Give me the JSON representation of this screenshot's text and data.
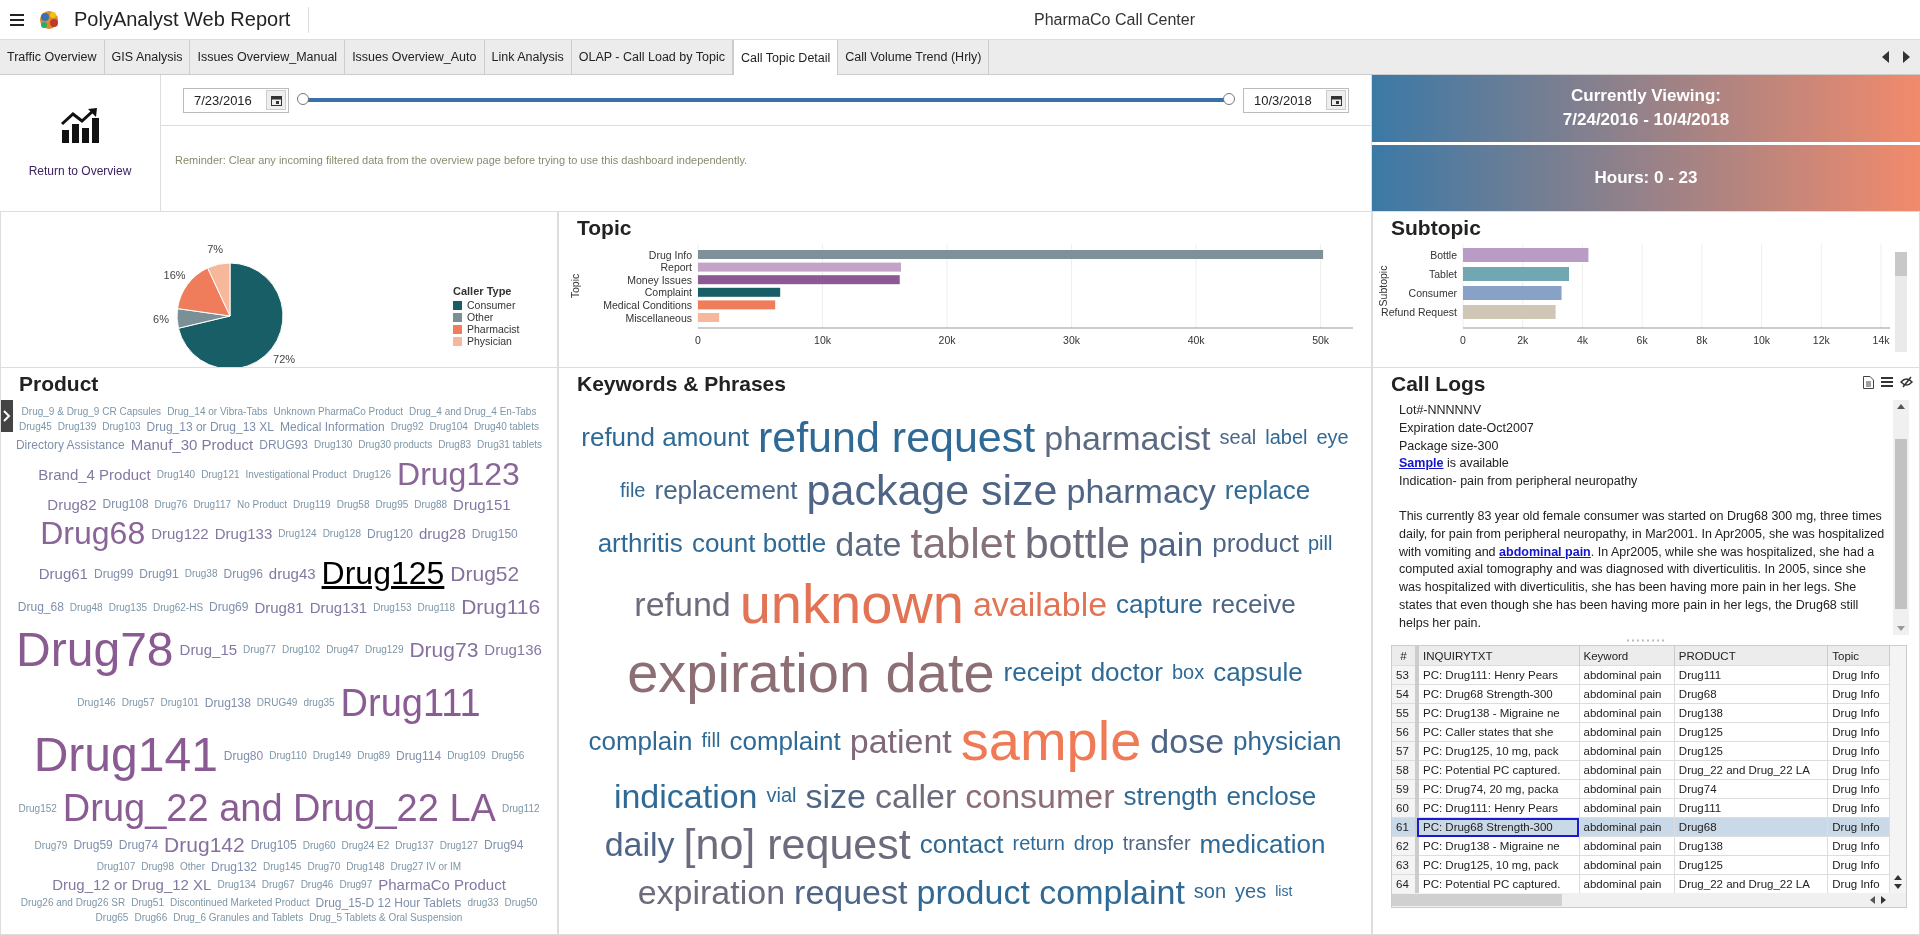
{
  "header": {
    "app_title": "PolyAnalyst Web Report",
    "report_title": "PharmaCo Call Center"
  },
  "tabs": [
    {
      "label": "Traffic Overview",
      "selected": false
    },
    {
      "label": "GIS Analysis",
      "selected": false
    },
    {
      "label": "Issues Overview_Manual",
      "selected": false
    },
    {
      "label": "Issues Overview_Auto",
      "selected": false
    },
    {
      "label": "Link Analysis",
      "selected": false
    },
    {
      "label": "OLAP - Call Load by Topic",
      "selected": false
    },
    {
      "label": "Call Topic Detail",
      "selected": true
    },
    {
      "label": "Call Volume Trend (Hrly)",
      "selected": false
    }
  ],
  "overview": {
    "return_link": "Return to Overview"
  },
  "filters": {
    "start_date": "7/23/2016",
    "end_date": "10/3/2018",
    "range_slider": {
      "level": 1
    },
    "reminder": "Reminder: Clear any incoming filtered data from the overview page before trying to use this dashboard independently."
  },
  "viewing": {
    "title": "Currently Viewing:",
    "range": "7/24/2016 - 10/4/2018",
    "hours": "Hours: 0 - 23"
  },
  "caller_type": {
    "chart_data": {
      "type": "pie",
      "legend": {
        "title": "Caller Type"
      },
      "categories": [
        "Consumer",
        "Other",
        "Pharmacist",
        "Physician"
      ],
      "values": [
        72,
        6,
        16,
        7
      ],
      "value_labels": [
        "72%",
        "6%",
        "16%",
        "7%"
      ],
      "colors": [
        "#175e66",
        "#7b8f97",
        "#ef7d5c",
        "#f7b79a"
      ]
    }
  },
  "topic": {
    "title": "Topic",
    "chart_data": {
      "type": "bar",
      "grid": true,
      "orientation": "horizontal",
      "ylabel": "Topic",
      "categories": [
        "Drug Info",
        "Report",
        "Money Issues",
        "Complaint",
        "Medical Conditions",
        "Miscellaneous"
      ],
      "values": [
        50200,
        16300,
        16200,
        6600,
        6200,
        1700
      ],
      "colors": [
        "#7e9199",
        "#c3a4c8",
        "#8b5a93",
        "#175e66",
        "#ef7d5c",
        "#f7b79a"
      ],
      "xlim": [
        0,
        52600
      ],
      "xticks": [
        {
          "value": 0,
          "label": "0"
        },
        {
          "value": 10000,
          "label": "10k"
        },
        {
          "value": 20000,
          "label": "20k"
        },
        {
          "value": 30000,
          "label": "30k"
        },
        {
          "value": 40000,
          "label": "40k"
        },
        {
          "value": 50000,
          "label": "50k"
        }
      ]
    }
  },
  "subtopic": {
    "title": "Subtopic",
    "chart_data": {
      "type": "bar",
      "grid": true,
      "orientation": "horizontal",
      "ylabel": "Subtopic",
      "categories": [
        "Bottle",
        "Tablet",
        "Consumer",
        "Refund Request"
      ],
      "values": [
        4200,
        3550,
        3300,
        3100
      ],
      "colors": [
        "#b99cc5",
        "#70a7b1",
        "#87a1c7",
        "#d0c6b6"
      ],
      "xlim": [
        0,
        14300
      ],
      "xticks": [
        {
          "value": 0,
          "label": "0"
        },
        {
          "value": 2000,
          "label": "2k"
        },
        {
          "value": 4000,
          "label": "4k"
        },
        {
          "value": 6000,
          "label": "6k"
        },
        {
          "value": 8000,
          "label": "8k"
        },
        {
          "value": 10000,
          "label": "10k"
        },
        {
          "value": 12000,
          "label": "12k"
        },
        {
          "value": 14000,
          "label": "14k"
        }
      ]
    }
  },
  "product": {
    "title": "Product",
    "words": [
      {
        "text": "Drug_9 & Drug_9 CR Capsules",
        "kind": "tiny",
        "selected": false
      },
      {
        "text": "Drug_14 or Vibra-Tabs",
        "kind": "tiny",
        "selected": false
      },
      {
        "text": "Unknown PharmaCo Product",
        "kind": "tiny",
        "selected": false
      },
      {
        "text": "Drug_4 and Drug_4 En-Tabs",
        "kind": "tiny",
        "selected": false
      },
      {
        "text": "Drug45",
        "kind": "tiny",
        "selected": false
      },
      {
        "text": "Drug139",
        "kind": "tiny",
        "selected": false
      },
      {
        "text": "Drug103",
        "kind": "tiny",
        "selected": false
      },
      {
        "text": "Drug_13 or Drug_13 XL",
        "kind": "small",
        "selected": false
      },
      {
        "text": "Medical Information",
        "kind": "small",
        "selected": false
      },
      {
        "text": "Drug92",
        "kind": "tiny",
        "selected": false
      },
      {
        "text": "Drug104",
        "kind": "tiny",
        "selected": false
      },
      {
        "text": "Drug40 tablets",
        "kind": "tiny",
        "selected": false
      },
      {
        "text": "Directory Assistance",
        "kind": "small",
        "selected": false
      },
      {
        "text": "Manuf_30 Product",
        "kind": "normal",
        "selected": false
      },
      {
        "text": "DRUG93",
        "kind": "small",
        "selected": false
      },
      {
        "text": "Drug130",
        "kind": "tiny",
        "selected": false
      },
      {
        "text": "Drug30 products",
        "kind": "tiny",
        "selected": false
      },
      {
        "text": "Drug83",
        "kind": "tiny",
        "selected": false
      },
      {
        "text": "Drug31 tablets",
        "kind": "tiny",
        "selected": false
      },
      {
        "text": "Brand_4 Product",
        "kind": "normal",
        "selected": false
      },
      {
        "text": "Drug140",
        "kind": "tiny",
        "selected": false
      },
      {
        "text": "Drug121",
        "kind": "tiny",
        "selected": false
      },
      {
        "text": "Investigational Product",
        "kind": "tiny",
        "selected": false
      },
      {
        "text": "Drug126",
        "kind": "tiny",
        "selected": false
      },
      {
        "text": "Drug123",
        "kind": "large",
        "selected": false
      },
      {
        "text": "Drug82",
        "kind": "normal",
        "selected": false
      },
      {
        "text": "Drug108",
        "kind": "small",
        "selected": false
      },
      {
        "text": "Drug76",
        "kind": "tiny",
        "selected": false
      },
      {
        "text": "Drug117",
        "kind": "tiny",
        "selected": false
      },
      {
        "text": "No Product",
        "kind": "tiny",
        "selected": false
      },
      {
        "text": "Drug119",
        "kind": "tiny",
        "selected": false
      },
      {
        "text": "Drug58",
        "kind": "tiny",
        "selected": false
      },
      {
        "text": "Drug95",
        "kind": "tiny",
        "selected": false
      },
      {
        "text": "Drug88",
        "kind": "tiny",
        "selected": false
      },
      {
        "text": "Drug151",
        "kind": "normal",
        "selected": false
      },
      {
        "text": "Drug68",
        "kind": "large",
        "selected": false
      },
      {
        "text": "Drug122",
        "kind": "normal",
        "selected": false
      },
      {
        "text": "Drug133",
        "kind": "normal",
        "selected": false
      },
      {
        "text": "Drug124",
        "kind": "tiny",
        "selected": false
      },
      {
        "text": "Drug128",
        "kind": "tiny",
        "selected": false
      },
      {
        "text": "Drug120",
        "kind": "small",
        "selected": false
      },
      {
        "text": "drug28",
        "kind": "normal",
        "selected": false
      },
      {
        "text": "Drug150",
        "kind": "small",
        "selected": false
      },
      {
        "text": "Drug61",
        "kind": "normal",
        "selected": false
      },
      {
        "text": "Drug99",
        "kind": "small",
        "selected": false
      },
      {
        "text": "Drug91",
        "kind": "small",
        "selected": false
      },
      {
        "text": "Drug38",
        "kind": "tiny",
        "selected": false
      },
      {
        "text": "Drug96",
        "kind": "small",
        "selected": false
      },
      {
        "text": "drug43",
        "kind": "normal",
        "selected": false
      },
      {
        "text": "Drug125",
        "kind": "large",
        "selected": true
      },
      {
        "text": "Drug52",
        "kind": "medium",
        "selected": false
      },
      {
        "text": "Drug_68",
        "kind": "small",
        "selected": false
      },
      {
        "text": "Drug48",
        "kind": "tiny",
        "selected": false
      },
      {
        "text": "Drug135",
        "kind": "tiny",
        "selected": false
      },
      {
        "text": "Drug62-HS",
        "kind": "tiny",
        "selected": false
      },
      {
        "text": "Drug69",
        "kind": "small",
        "selected": false
      },
      {
        "text": "Drug81",
        "kind": "normal",
        "selected": false
      },
      {
        "text": "Drug131",
        "kind": "normal",
        "selected": false
      },
      {
        "text": "Drug153",
        "kind": "tiny",
        "selected": false
      },
      {
        "text": "Drug118",
        "kind": "tiny",
        "selected": false
      },
      {
        "text": "Drug116",
        "kind": "medium",
        "selected": false
      },
      {
        "text": "Drug78",
        "kind": "huge",
        "selected": false
      },
      {
        "text": "Drug_15",
        "kind": "normal",
        "selected": false
      },
      {
        "text": "Drug77",
        "kind": "tiny",
        "selected": false
      },
      {
        "text": "Drug102",
        "kind": "tiny",
        "selected": false
      },
      {
        "text": "Drug47",
        "kind": "tiny",
        "selected": false
      },
      {
        "text": "Drug129",
        "kind": "tiny",
        "selected": false
      },
      {
        "text": "Drug73",
        "kind": "medium",
        "selected": false
      },
      {
        "text": "Drug136",
        "kind": "normal",
        "selected": false
      },
      {
        "text": "Drug146",
        "kind": "tiny",
        "selected": false
      },
      {
        "text": "Drug57",
        "kind": "tiny",
        "selected": false
      },
      {
        "text": "Drug101",
        "kind": "tiny",
        "selected": false
      },
      {
        "text": "Drug138",
        "kind": "small",
        "selected": false
      },
      {
        "text": "DRUG49",
        "kind": "tiny",
        "selected": false
      },
      {
        "text": "drug35",
        "kind": "tiny",
        "selected": false
      },
      {
        "text": "Drug111",
        "kind": "xlarge",
        "selected": false
      },
      {
        "text": "Drug141",
        "kind": "huge",
        "selected": false
      },
      {
        "text": "Drug80",
        "kind": "small",
        "selected": false
      },
      {
        "text": "Drug110",
        "kind": "tiny",
        "selected": false
      },
      {
        "text": "Drug149",
        "kind": "tiny",
        "selected": false
      },
      {
        "text": "Drug89",
        "kind": "tiny",
        "selected": false
      },
      {
        "text": "Drug114",
        "kind": "small",
        "selected": false
      },
      {
        "text": "Drug109",
        "kind": "tiny",
        "selected": false
      },
      {
        "text": "Drug56",
        "kind": "tiny",
        "selected": false
      },
      {
        "text": "Drug152",
        "kind": "tiny",
        "selected": false
      },
      {
        "text": "Drug_22 and Drug_22 LA",
        "kind": "xlarge",
        "selected": false
      },
      {
        "text": "Drug112",
        "kind": "tiny",
        "selected": false
      },
      {
        "text": "Drug79",
        "kind": "tiny",
        "selected": false
      },
      {
        "text": "Drug59",
        "kind": "small",
        "selected": false
      },
      {
        "text": "Drug74",
        "kind": "small",
        "selected": false
      },
      {
        "text": "Drug142",
        "kind": "medium",
        "selected": false
      },
      {
        "text": "Drug105",
        "kind": "small",
        "selected": false
      },
      {
        "text": "Drug60",
        "kind": "tiny",
        "selected": false
      },
      {
        "text": "Drug24 E2",
        "kind": "tiny",
        "selected": false
      },
      {
        "text": "Drug137",
        "kind": "tiny",
        "selected": false
      },
      {
        "text": "Drug127",
        "kind": "tiny",
        "selected": false
      },
      {
        "text": "Drug94",
        "kind": "small",
        "selected": false
      },
      {
        "text": "Drug107",
        "kind": "tiny",
        "selected": false
      },
      {
        "text": "Drug98",
        "kind": "tiny",
        "selected": false
      },
      {
        "text": "Other",
        "kind": "tiny",
        "selected": false
      },
      {
        "text": "Drug132",
        "kind": "small",
        "selected": false
      },
      {
        "text": "Drug145",
        "kind": "tiny",
        "selected": false
      },
      {
        "text": "Drug70",
        "kind": "tiny",
        "selected": false
      },
      {
        "text": "Drug148",
        "kind": "tiny",
        "selected": false
      },
      {
        "text": "Drug27 IV or IM",
        "kind": "tiny",
        "selected": false
      },
      {
        "text": "Drug_12 or Drug_12 XL",
        "kind": "normal",
        "selected": false
      },
      {
        "text": "Drug134",
        "kind": "tiny",
        "selected": false
      },
      {
        "text": "Drug67",
        "kind": "tiny",
        "selected": false
      },
      {
        "text": "Drug46",
        "kind": "tiny",
        "selected": false
      },
      {
        "text": "Drug97",
        "kind": "tiny",
        "selected": false
      },
      {
        "text": "PharmaCo Product",
        "kind": "normal",
        "selected": false
      },
      {
        "text": "Drug26 and Drug26 SR",
        "kind": "tiny",
        "selected": false
      },
      {
        "text": "Drug51",
        "kind": "tiny",
        "selected": false
      },
      {
        "text": "Discontinued Marketed Product",
        "kind": "tiny",
        "selected": false
      },
      {
        "text": "Drug_15-D 12 Hour Tablets",
        "kind": "small",
        "selected": false
      },
      {
        "text": "drug33",
        "kind": "tiny",
        "selected": false
      },
      {
        "text": "Drug50",
        "kind": "tiny",
        "selected": false
      },
      {
        "text": "Drug65",
        "kind": "tiny",
        "selected": false
      },
      {
        "text": "Drug66",
        "kind": "tiny",
        "selected": false
      },
      {
        "text": "Drug_6 Granules and Tablets",
        "kind": "tiny",
        "selected": false
      },
      {
        "text": "Drug_5 Tablets & Oral Suspension",
        "kind": "tiny",
        "selected": false
      }
    ]
  },
  "keywords": {
    "title": "Keywords & Phrases",
    "words": [
      {
        "text": "refund amount",
        "kind": "m",
        "color": "#2f6a96"
      },
      {
        "text": "refund request",
        "kind": "xl",
        "color": "#2f6a96"
      },
      {
        "text": "pharmacist",
        "kind": "l",
        "color": "#5b6a80"
      },
      {
        "text": "seal",
        "kind": "s",
        "color": "#4a6788"
      },
      {
        "text": "label",
        "kind": "s",
        "color": "#2f6a96"
      },
      {
        "text": "eye",
        "kind": "s",
        "color": "#2f6a96"
      },
      {
        "text": "file",
        "kind": "s",
        "color": "#2f6a96"
      },
      {
        "text": "replacement",
        "kind": "m",
        "color": "#4a6788"
      },
      {
        "text": "package size",
        "kind": "xl",
        "color": "#4e6585"
      },
      {
        "text": "pharmacy",
        "kind": "l",
        "color": "#4e6585"
      },
      {
        "text": "replace",
        "kind": "m",
        "color": "#2f6a96"
      },
      {
        "text": "arthritis",
        "kind": "m",
        "color": "#2f6a96"
      },
      {
        "text": "count bottle",
        "kind": "m",
        "color": "#2f6a96"
      },
      {
        "text": "date",
        "kind": "l",
        "color": "#5b6a80"
      },
      {
        "text": "tablet",
        "kind": "xl",
        "color": "#86707a"
      },
      {
        "text": "bottle",
        "kind": "xl",
        "color": "#6f6a7c"
      },
      {
        "text": "pain",
        "kind": "l",
        "color": "#4e6585"
      },
      {
        "text": "product",
        "kind": "m",
        "color": "#4e6585"
      },
      {
        "text": "pill",
        "kind": "s",
        "color": "#2f6a96"
      },
      {
        "text": "refund",
        "kind": "l",
        "color": "#6f6a7c"
      },
      {
        "text": "unknown",
        "kind": "xxl",
        "color": "#e27455"
      },
      {
        "text": "available",
        "kind": "l",
        "color": "#e27455"
      },
      {
        "text": "capture",
        "kind": "m",
        "color": "#2f6a96"
      },
      {
        "text": "receive",
        "kind": "m",
        "color": "#4e6585"
      },
      {
        "text": "expiration date",
        "kind": "xxl",
        "color": "#8d6e75"
      },
      {
        "text": "receipt",
        "kind": "m",
        "color": "#2f6a96"
      },
      {
        "text": "doctor",
        "kind": "m",
        "color": "#2f6a96"
      },
      {
        "text": "box",
        "kind": "s",
        "color": "#2f6a96"
      },
      {
        "text": "capsule",
        "kind": "m",
        "color": "#2f6a96"
      },
      {
        "text": "complain",
        "kind": "m",
        "color": "#2f6a96"
      },
      {
        "text": "fill",
        "kind": "s",
        "color": "#2f6a96"
      },
      {
        "text": "complaint",
        "kind": "m",
        "color": "#2f6a96"
      },
      {
        "text": "patient",
        "kind": "l",
        "color": "#80697a"
      },
      {
        "text": "sample",
        "kind": "xxl",
        "color": "#ef7a55"
      },
      {
        "text": "dose",
        "kind": "l",
        "color": "#4e6585"
      },
      {
        "text": "physician",
        "kind": "m",
        "color": "#2f6a96"
      },
      {
        "text": "indication",
        "kind": "l",
        "color": "#2f6a96"
      },
      {
        "text": "vial",
        "kind": "s",
        "color": "#2f6a96"
      },
      {
        "text": "size",
        "kind": "l",
        "color": "#4e6585"
      },
      {
        "text": "caller",
        "kind": "l",
        "color": "#6f6a7c"
      },
      {
        "text": "consumer",
        "kind": "l",
        "color": "#8d6e75"
      },
      {
        "text": "strength",
        "kind": "m",
        "color": "#2f6a96"
      },
      {
        "text": "enclose",
        "kind": "m",
        "color": "#2f6a96"
      },
      {
        "text": "daily",
        "kind": "l",
        "color": "#4e6585"
      },
      {
        "text": "[no] request",
        "kind": "xl",
        "color": "#6f6a7c"
      },
      {
        "text": "contact",
        "kind": "m",
        "color": "#2f6a96"
      },
      {
        "text": "return",
        "kind": "s",
        "color": "#2f6a96"
      },
      {
        "text": "drop",
        "kind": "s",
        "color": "#2f6a96"
      },
      {
        "text": "transfer",
        "kind": "s",
        "color": "#4e6585"
      },
      {
        "text": "medication",
        "kind": "m",
        "color": "#2f6a96"
      },
      {
        "text": "expiration",
        "kind": "l",
        "color": "#6f6a7c"
      },
      {
        "text": "request",
        "kind": "l",
        "color": "#4e6585"
      },
      {
        "text": "product complaint",
        "kind": "l",
        "color": "#2f6a96"
      },
      {
        "text": "son",
        "kind": "s",
        "color": "#2f6a96"
      },
      {
        "text": "yes",
        "kind": "s",
        "color": "#2f6a96"
      },
      {
        "text": "list",
        "kind": "xs",
        "color": "#2f6a96"
      }
    ]
  },
  "call_logs": {
    "title": "Call Logs",
    "lines": [
      {
        "parts": [
          {
            "kind": "text",
            "text": "Lot#-NNNNNV"
          }
        ]
      },
      {
        "parts": [
          {
            "kind": "text",
            "text": "Expiration date-Oct2007"
          }
        ]
      },
      {
        "parts": [
          {
            "kind": "text",
            "text": "Package size-300"
          }
        ]
      },
      {
        "parts": [
          {
            "kind": "link",
            "text": "Sample"
          },
          {
            "kind": "text",
            "text": " is available"
          }
        ]
      },
      {
        "parts": [
          {
            "kind": "text",
            "text": "Indication- pain from peripheral neuropathy"
          }
        ]
      }
    ],
    "paragraph": {
      "parts": [
        {
          "kind": "text",
          "text": "This currently 83 year old female consumer was started on Drug68 300 mg, three times daily, for pain from peripheral neuropathy, in Mar2001. In Apr2005, she was hospitalized with vomiting and "
        },
        {
          "kind": "link",
          "text": "abdominal pain"
        },
        {
          "kind": "text",
          "text": ". In Apr2005, while she was hospitalized, she had a computed axial tomography and was diagnosed with diverticulitis. In 2005, since she was hospitalized with diverticulitis, she has been having more pain in her legs. She states that even though she has been having more pain in her legs, the Drug68 still helps her pain."
        }
      ]
    },
    "table": {
      "columns": [
        "#",
        "INQUIRYTXT",
        "Keyword",
        "PRODUCT",
        "Topic"
      ],
      "rows": [
        {
          "cells": [
            "53",
            "PC: Drug111: Henry Pears",
            "abdominal pain",
            "Drug111",
            "Drug Info"
          ],
          "selected": false
        },
        {
          "cells": [
            "54",
            "PC: Drug68 Strength-300",
            "abdominal pain",
            "Drug68",
            "Drug Info"
          ],
          "selected": false
        },
        {
          "cells": [
            "55",
            "PC: Drug138 - Migraine ne",
            "abdominal pain",
            "Drug138",
            "Drug Info"
          ],
          "selected": false
        },
        {
          "cells": [
            "56",
            "PC: Caller states that she",
            "abdominal pain",
            "Drug125",
            "Drug Info"
          ],
          "selected": false
        },
        {
          "cells": [
            "57",
            "PC: Drug125, 10 mg, pack",
            "abdominal pain",
            "Drug125",
            "Drug Info"
          ],
          "selected": false
        },
        {
          "cells": [
            "58",
            "PC: Potential PC captured.",
            "abdominal pain",
            "Drug_22 and Drug_22 LA",
            "Drug Info"
          ],
          "selected": false
        },
        {
          "cells": [
            "59",
            "PC: Drug74, 20 mg, packa",
            "abdominal pain",
            "Drug74",
            "Drug Info"
          ],
          "selected": false
        },
        {
          "cells": [
            "60",
            "PC: Drug111: Henry Pears",
            "abdominal pain",
            "Drug111",
            "Drug Info"
          ],
          "selected": false
        },
        {
          "cells": [
            "61",
            "PC: Drug68 Strength-300",
            "abdominal pain",
            "Drug68",
            "Drug Info"
          ],
          "selected": true
        },
        {
          "cells": [
            "62",
            "PC: Drug138 - Migraine ne",
            "abdominal pain",
            "Drug138",
            "Drug Info"
          ],
          "selected": false
        },
        {
          "cells": [
            "63",
            "PC: Drug125, 10 mg, pack",
            "abdominal pain",
            "Drug125",
            "Drug Info"
          ],
          "selected": false
        },
        {
          "cells": [
            "64",
            "PC: Potential PC captured.",
            "abdominal pain",
            "Drug_22 and Drug_22 LA",
            "Drug Info"
          ],
          "selected": false
        }
      ]
    }
  }
}
